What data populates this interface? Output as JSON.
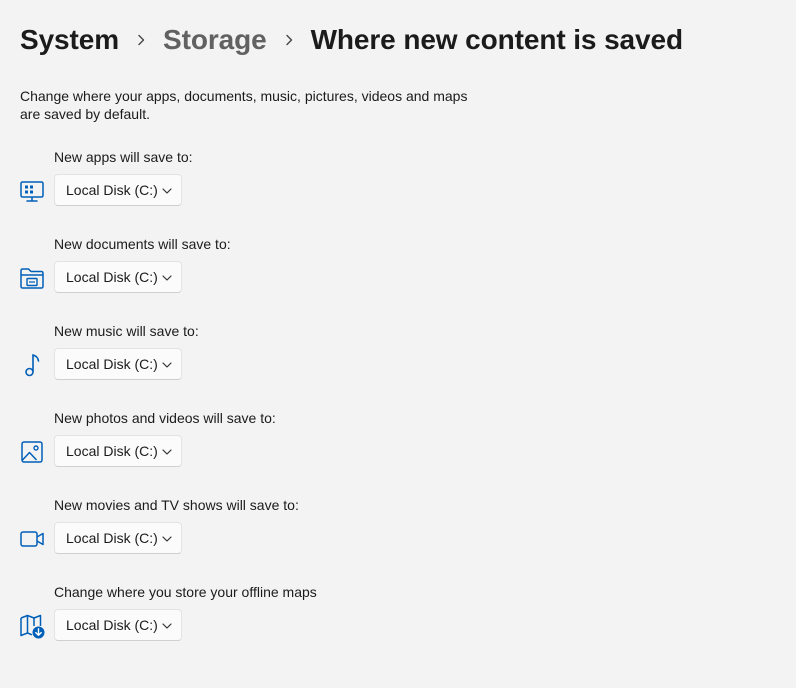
{
  "breadcrumb": {
    "items": [
      "System",
      "Storage",
      "Where new content is saved"
    ]
  },
  "description": "Change where your apps, documents, music, pictures, videos and maps are saved by default.",
  "accent_color": "#005fb8",
  "settings": [
    {
      "label": "New apps will save to:",
      "value": "Local Disk (C:)",
      "icon": "apps-pc-icon"
    },
    {
      "label": "New documents will save to:",
      "value": "Local Disk (C:)",
      "icon": "documents-folder-icon"
    },
    {
      "label": "New music will save to:",
      "value": "Local Disk (C:)",
      "icon": "music-note-icon"
    },
    {
      "label": "New photos and videos will save to:",
      "value": "Local Disk (C:)",
      "icon": "photo-icon"
    },
    {
      "label": "New movies and TV shows will save to:",
      "value": "Local Disk (C:)",
      "icon": "video-camera-icon"
    },
    {
      "label": "Change where you store your offline maps",
      "value": "Local Disk (C:)",
      "icon": "offline-map-icon"
    }
  ]
}
